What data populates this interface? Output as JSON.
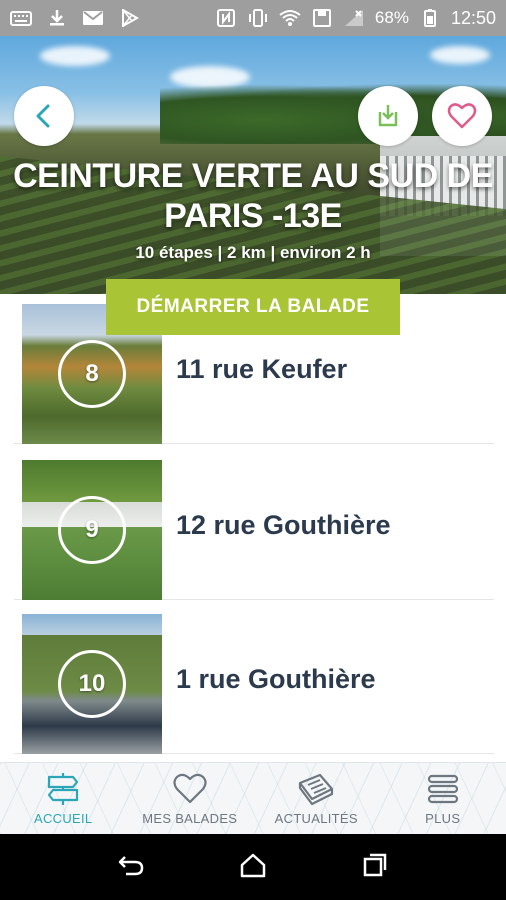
{
  "status_bar": {
    "icons": [
      "keyboard-icon",
      "download-icon",
      "gmail-icon",
      "play-store-icon"
    ],
    "right_icons": [
      "nfc-icon",
      "vibrate-icon",
      "wifi-icon",
      "save-icon",
      "signal-icon"
    ],
    "battery": "68%",
    "time": "12:50"
  },
  "hero": {
    "title": "CEINTURE VERTE AU SUD DE PARIS -13E",
    "meta": "10 étapes | 2 km | environ 2 h",
    "start_button": "DÉMARRER LA BALADE",
    "colors": {
      "back_icon": "#2aa6b6",
      "download_icon": "#7bbf5a",
      "heart_icon": "#e05a8a",
      "start_bg": "#a9c434"
    }
  },
  "steps": [
    {
      "number": "8",
      "label": "11 rue Keufer"
    },
    {
      "number": "9",
      "label": "12 rue Gouthière"
    },
    {
      "number": "10",
      "label": "1 rue Gouthière"
    }
  ],
  "bottom_nav": [
    {
      "label": "ACCUEIL",
      "icon": "signpost-icon",
      "active": true
    },
    {
      "label": "MES BALADES",
      "icon": "heart-icon",
      "active": false
    },
    {
      "label": "ACTUALITÉS",
      "icon": "newspaper-icon",
      "active": false
    },
    {
      "label": "PLUS",
      "icon": "menu-icon",
      "active": false
    }
  ],
  "system_nav": [
    "back-icon",
    "home-icon",
    "recents-icon"
  ]
}
